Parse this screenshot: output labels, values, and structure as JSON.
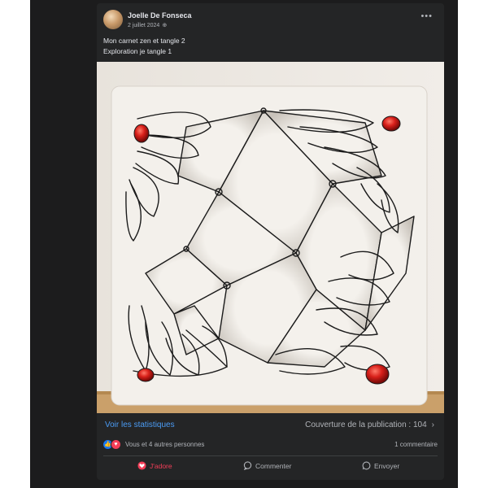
{
  "post": {
    "author": "Joelle De Fonseca",
    "date": "2 juillet 2024",
    "privacy_icon": "globe-icon",
    "more_icon": "more-icon",
    "caption_lines": [
      "Mon carnet zen et tangle 2",
      "Exploration je tangle 1"
    ]
  },
  "stats": {
    "link": "Voir les statistiques",
    "reach": "Couverture de la publication : 104"
  },
  "reactions": {
    "summary": "Vous et 4 autres personnes",
    "comments": "1 commentaire"
  },
  "actions": {
    "like": "J'adore",
    "comment": "Commenter",
    "share": "Envoyer"
  },
  "colors": {
    "card_bg": "#242526",
    "link": "#4b9cf5",
    "love": "#f33e58",
    "like": "#1877f2"
  }
}
